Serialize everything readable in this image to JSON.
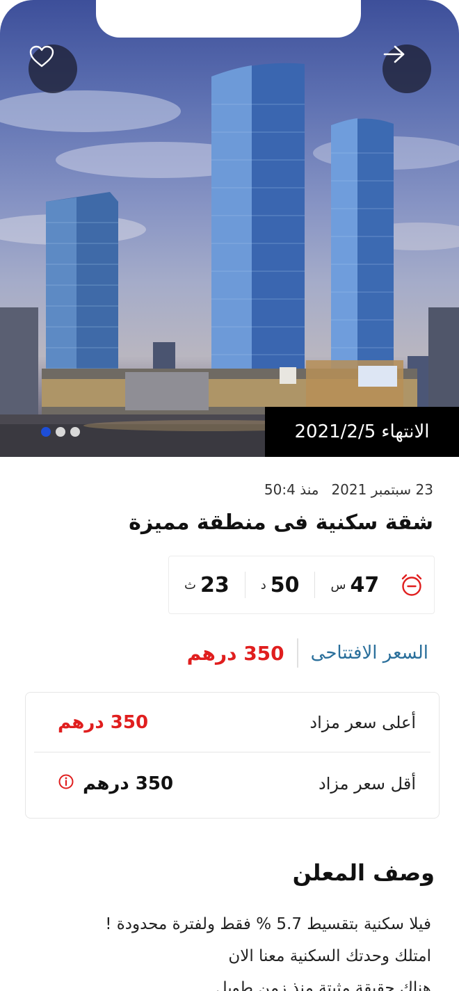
{
  "hero": {
    "end_label": "الانتهاء",
    "end_date": "2021/2/5",
    "image_dots": 3,
    "active_dot": 0
  },
  "listing": {
    "date": "23 سبتمبر 2021",
    "elapsed": "منذ 50:4",
    "title": "شقة سكنية فى منطقة مميزة"
  },
  "timer": {
    "hours": "47",
    "hours_unit": "س",
    "minutes": "50",
    "minutes_unit": "د",
    "seconds": "23",
    "seconds_unit": "ث"
  },
  "opening_price": {
    "label": "السعر الافتتاحى",
    "value": "350 درهم"
  },
  "bids": {
    "highest_label": "أعلى سعر مزاد",
    "highest_value": "350 درهم",
    "lowest_label": "أقل سعر مزاد",
    "lowest_value": "350 درهم"
  },
  "description": {
    "title": "وصف المعلن",
    "lines": [
      "فيلا سكنية بتقسيط 5.7 % فقط ولفترة محدودة !",
      "امتلك وحدتك السكنية معنا الان",
      "هناك حقيقة مثبتة منذ زمن طويل"
    ]
  },
  "colors": {
    "accent_blue": "#2a6f9b",
    "price_red": "#e01e1e",
    "dot_active": "#1d4ed8"
  },
  "icons": {
    "favorite": "heart-icon",
    "back": "arrow-right-icon",
    "timer": "alarm-clock-icon",
    "info": "info-icon"
  }
}
